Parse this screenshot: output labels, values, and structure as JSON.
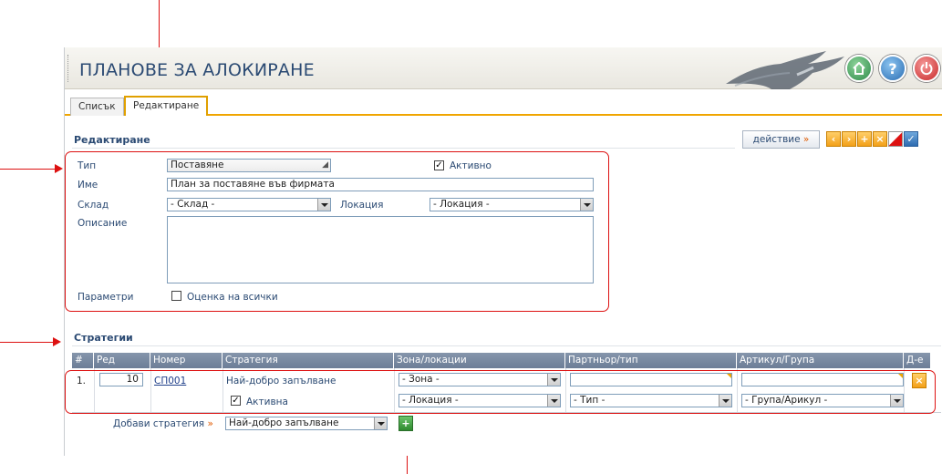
{
  "header": {
    "title": "ПЛАНОВЕ ЗА АЛОКИРАНЕ"
  },
  "tabs": [
    {
      "label": "Списък",
      "active": false
    },
    {
      "label": "Редактиране",
      "active": true
    }
  ],
  "edit_section": {
    "title": "Редактиране"
  },
  "action_bar": {
    "action_label": "действие",
    "action_arrow": "»"
  },
  "form": {
    "type_label": "Тип",
    "type_value": "Поставяне",
    "active_label": "Активно",
    "active_checked": true,
    "name_label": "Име",
    "name_value": "План за поставяне във фирмата",
    "warehouse_label": "Склад",
    "warehouse_value": "- Склад -",
    "location_label": "Локация",
    "location_value": "- Локация -",
    "description_label": "Описание",
    "description_value": "",
    "params_label": "Параметри",
    "evaluate_all_label": "Оценка на всички",
    "evaluate_all_checked": false
  },
  "strategies": {
    "title": "Стратегии",
    "columns": [
      "#",
      "Ред",
      "Номер",
      "Стратегия",
      "Зона/локации",
      "Партньор/тип",
      "Артикул/Група",
      "Д-е"
    ],
    "rows": [
      {
        "index": "1.",
        "order": "10",
        "number": "СП001",
        "strategy": "Най-добро запълване",
        "active_label": "Активна",
        "active_checked": true,
        "zone": "- Зона -",
        "location": "- Локация -",
        "partner": "",
        "partner_type": "- Тип -",
        "article": "",
        "article_group": "- Група/Арикул -"
      }
    ],
    "add_label": "Добави стратегия",
    "add_arrow": "»",
    "add_select_value": "Най-добро запълване"
  },
  "colors": {
    "accent": "#f0a500",
    "title": "#2b4a73",
    "annotation": "#dd1111",
    "grid_header": "#7889a2"
  }
}
